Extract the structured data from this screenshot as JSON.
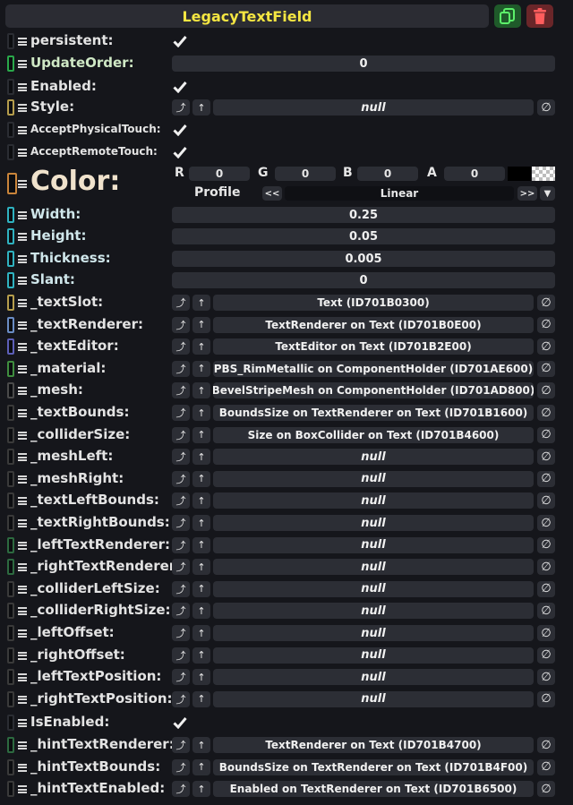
{
  "header": {
    "title": "LegacyTextField",
    "duplicate_icon": "copy-icon",
    "delete_icon": "trash-icon"
  },
  "colors": {
    "title": "#f5e642",
    "duplicate_bg": "#1f5a2a",
    "duplicate_fg": "#5cf06a",
    "delete_bg": "#6a2629",
    "delete_fg": "#ff5d5d"
  },
  "fields": {
    "persistent": {
      "label": "persistent:",
      "checked": true
    },
    "update_order": {
      "label": "UpdateOrder:",
      "value": "0"
    },
    "enabled": {
      "label": "Enabled:",
      "checked": true
    },
    "style": {
      "label": "Style:",
      "value": "null"
    },
    "accept_physical_touch": {
      "label": "AcceptPhysicalTouch:",
      "checked": true
    },
    "accept_remote_touch": {
      "label": "AcceptRemoteTouch:",
      "checked": true
    },
    "color": {
      "label": "Color:",
      "r_label": "R",
      "r": "0",
      "g_label": "G",
      "g": "0",
      "b_label": "B",
      "b": "0",
      "a_label": "A",
      "a": "0",
      "profile_label": "Profile",
      "profile_prev": "<<",
      "profile_value": "Linear",
      "profile_next": ">>",
      "profile_dropdown": "▼"
    },
    "width": {
      "label": "Width:",
      "value": "0.25"
    },
    "height": {
      "label": "Height:",
      "value": "0.05"
    },
    "thickness": {
      "label": "Thickness:",
      "value": "0.005"
    },
    "slant": {
      "label": "Slant:",
      "value": "0"
    },
    "refs": [
      {
        "label": "_textSlot:",
        "value": "Text (ID701B0300)"
      },
      {
        "label": "_textRenderer:",
        "value": "TextRenderer on Text (ID701B0E00)"
      },
      {
        "label": "_textEditor:",
        "value": "TextEditor on Text (ID701B2E00)"
      },
      {
        "label": "_material:",
        "value": "PBS_RimMetallic on ComponentHolder (ID701AE600)"
      },
      {
        "label": "_mesh:",
        "value": "BevelStripeMesh on ComponentHolder (ID701AD800)"
      },
      {
        "label": "_textBounds:",
        "value": "BoundsSize on TextRenderer on Text (ID701B1600)"
      },
      {
        "label": "_colliderSize:",
        "value": "Size on BoxCollider on Text (ID701B4600)"
      },
      {
        "label": "_meshLeft:",
        "value": "null"
      },
      {
        "label": "_meshRight:",
        "value": "null"
      },
      {
        "label": "_textLeftBounds:",
        "value": "null"
      },
      {
        "label": "_textRightBounds:",
        "value": "null"
      },
      {
        "label": "_leftTextRenderer:",
        "value": "null"
      },
      {
        "label": "_rightTextRenderer:",
        "value": "null"
      },
      {
        "label": "_colliderLeftSize:",
        "value": "null"
      },
      {
        "label": "_colliderRightSize:",
        "value": "null"
      },
      {
        "label": "_leftOffset:",
        "value": "null"
      },
      {
        "label": "_rightOffset:",
        "value": "null"
      },
      {
        "label": "_leftTextPosition:",
        "value": "null"
      },
      {
        "label": "_rightTextPosition:",
        "value": "null"
      }
    ],
    "is_enabled": {
      "label": "IsEnabled:",
      "checked": true
    },
    "refs2": [
      {
        "label": "_hintTextRenderer:",
        "value": "TextRenderer on Text (ID701B4700)"
      },
      {
        "label": "_hintTextBounds:",
        "value": "BoundsSize on TextRenderer on Text (ID701B4F00)"
      },
      {
        "label": "_hintTextEnabled:",
        "value": "Enabled on TextRenderer on Text (ID701B6500)"
      }
    ]
  },
  "icons": {
    "check": "checkmark-icon",
    "jump": "jump-to-icon",
    "up": "arrow-up-icon",
    "clear": "clear-null-icon",
    "drag": "drag-handle-icon",
    "connector": "connector-icon"
  }
}
